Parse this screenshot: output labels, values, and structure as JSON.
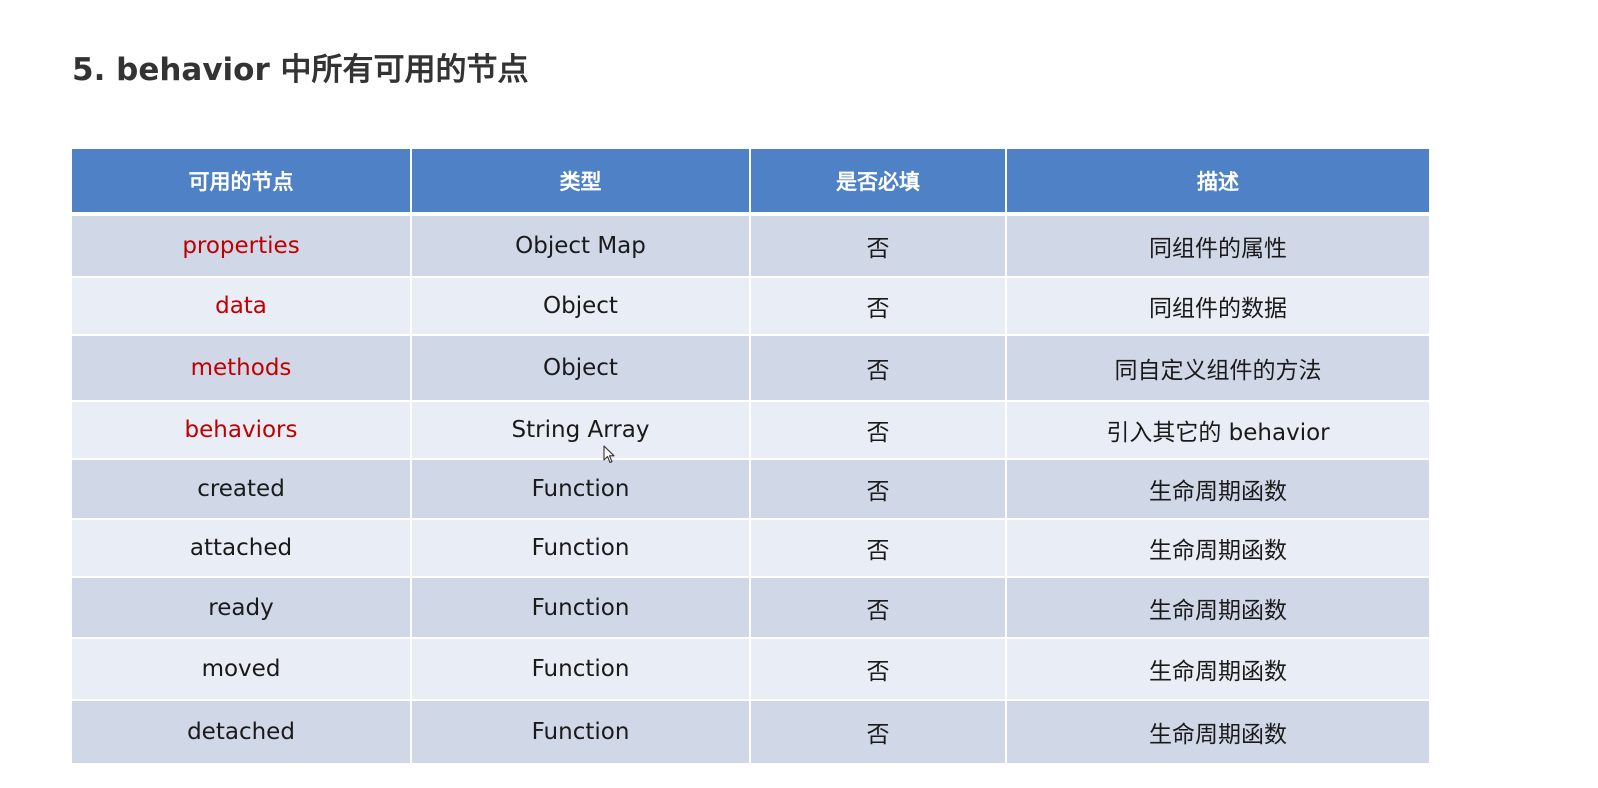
{
  "title": "5. behavior 中所有可用的节点",
  "table": {
    "headers": [
      "可用的节点",
      "类型",
      "是否必填",
      "描述"
    ],
    "rows": [
      {
        "node": "properties",
        "type": "Object Map",
        "required": "否",
        "desc": "同组件的属性",
        "highlight": true
      },
      {
        "node": "data",
        "type": "Object",
        "required": "否",
        "desc": "同组件的数据",
        "highlight": true
      },
      {
        "node": "methods",
        "type": "Object",
        "required": "否",
        "desc": "同自定义组件的方法",
        "highlight": true
      },
      {
        "node": "behaviors",
        "type": "String Array",
        "required": "否",
        "desc": "引入其它的 behavior",
        "highlight": true
      },
      {
        "node": "created",
        "type": "Function",
        "required": "否",
        "desc": "生命周期函数",
        "highlight": false
      },
      {
        "node": "attached",
        "type": "Function",
        "required": "否",
        "desc": "生命周期函数",
        "highlight": false
      },
      {
        "node": "ready",
        "type": "Function",
        "required": "否",
        "desc": "生命周期函数",
        "highlight": false
      },
      {
        "node": "moved",
        "type": "Function",
        "required": "否",
        "desc": "生命周期函数",
        "highlight": false
      },
      {
        "node": "detached",
        "type": "Function",
        "required": "否",
        "desc": "生命周期函数",
        "highlight": false
      }
    ]
  },
  "colors": {
    "header_bg": "#4f81c7",
    "row_odd_bg": "#d0d8e8",
    "row_even_bg": "#e9edf5",
    "highlight_text": "#c00000"
  },
  "cursor_icon": "mouse-pointer-icon"
}
